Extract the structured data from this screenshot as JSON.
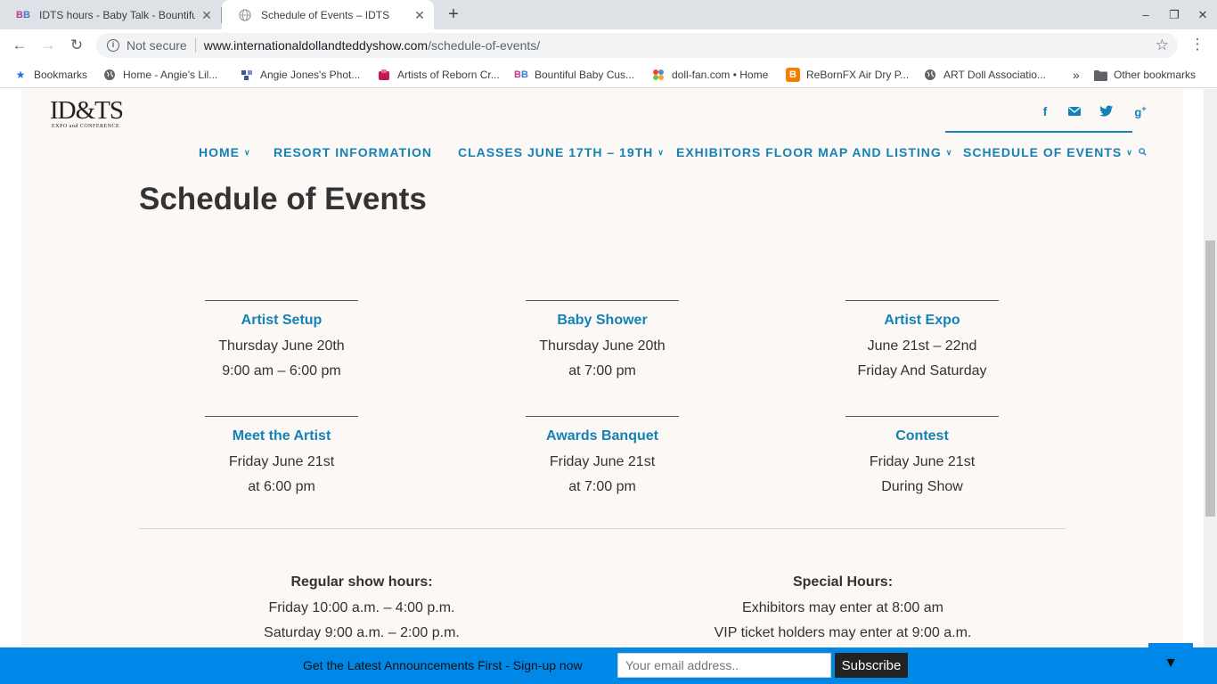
{
  "browser": {
    "tabs": [
      {
        "title": "IDTS hours - Baby Talk - Bountifu",
        "favicon": "BB",
        "active": false
      },
      {
        "title": "Schedule of Events – IDTS",
        "favicon": "globe",
        "active": true
      }
    ],
    "new_tab_label": "+",
    "window_controls": {
      "minimize": "–",
      "maximize": "❐",
      "close": "✕"
    },
    "address": {
      "security_label": "Not secure",
      "host": "www.internationaldollandteddyshow.com",
      "path": "/schedule-of-events/"
    },
    "bookmarks": [
      {
        "label": "Bookmarks",
        "icon": "star-icon"
      },
      {
        "label": "Home - Angie's Lil...",
        "icon": "globe-icon"
      },
      {
        "label": "Angie Jones's Phot...",
        "icon": "flickr-icon"
      },
      {
        "label": "Artists of Reborn Cr...",
        "icon": "site-icon"
      },
      {
        "label": "Bountiful Baby Cus...",
        "icon": "bb-icon"
      },
      {
        "label": "doll-fan.com • Home",
        "icon": "joomla-icon"
      },
      {
        "label": "ReBornFX Air Dry P...",
        "icon": "blogger-icon"
      },
      {
        "label": "ART Doll Associatio...",
        "icon": "globe-icon"
      }
    ],
    "overflow_label": "»",
    "other_bookmarks": "Other bookmarks"
  },
  "site": {
    "logo": {
      "main": "ID&TS",
      "sub": "EXPO and CONFERENCE"
    },
    "social": [
      "facebook-icon",
      "email-icon",
      "twitter-icon",
      "google-plus-icon"
    ],
    "nav": [
      {
        "label": "HOME",
        "dropdown": true
      },
      {
        "label": "RESORT INFORMATION",
        "dropdown": false
      },
      {
        "label": "CLASSES JUNE 17TH – 19TH",
        "dropdown": true
      },
      {
        "label": "EXHIBITORS FLOOR MAP AND LISTING",
        "dropdown": true
      },
      {
        "label": "SCHEDULE OF EVENTS",
        "dropdown": true
      }
    ],
    "accent_color": "#1582b5"
  },
  "page": {
    "title": "Schedule of Events",
    "events": [
      {
        "name": "Artist Setup",
        "line1": "Thursday June 20th",
        "line2": "9:00 am – 6:00 pm"
      },
      {
        "name": "Baby Shower",
        "line1": "Thursday June 20th",
        "line2": "at 7:00 pm"
      },
      {
        "name": "Artist Expo",
        "line1": "June 21st – 22nd",
        "line2": "Friday And Saturday"
      },
      {
        "name": "Meet the Artist",
        "line1": "Friday June 21st",
        "line2": "at 6:00 pm"
      },
      {
        "name": "Awards Banquet",
        "line1": "Friday June 21st",
        "line2": "at 7:00 pm"
      },
      {
        "name": "Contest",
        "line1": "Friday June 21st",
        "line2": "During Show"
      }
    ],
    "regular_hours": {
      "heading": "Regular show hours:",
      "lines": [
        "Friday 10:00 a.m. – 4:00 p.m.",
        "Saturday 9:00 a.m. – 2:00 p.m."
      ]
    },
    "special_hours": {
      "heading": "Special Hours:",
      "lines": [
        "Exhibitors may enter at 8:00 am",
        "VIP ticket holders may enter at 9:00 a.m."
      ]
    }
  },
  "signup": {
    "text": "Get the Latest Announcements First - Sign-up now",
    "placeholder": "Your email address..",
    "button": "Subscribe",
    "toggle": "▼",
    "bar_color": "#0088e8"
  }
}
